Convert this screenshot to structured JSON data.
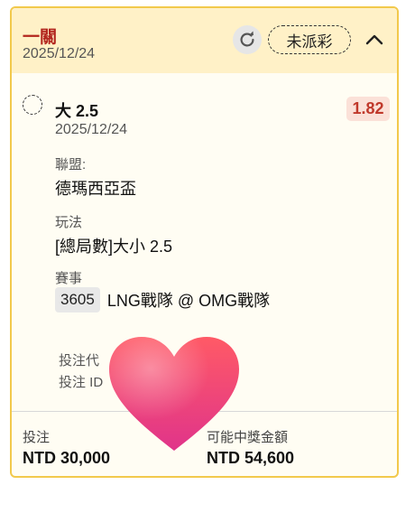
{
  "header": {
    "bet_type": "一關",
    "date": "2025/12/24",
    "status": "未派彩",
    "refresh_icon": "refresh-icon",
    "collapse_icon": "chevron-up-icon"
  },
  "selection": {
    "title": "大 2.5",
    "odds": "1.82",
    "date": "2025/12/24"
  },
  "details": {
    "league_label": "聯盟:",
    "league_value": "德瑪西亞盃",
    "market_label": "玩法",
    "market_value": "[總局數]大小 2.5",
    "event_label": "賽事",
    "match_id": "3605",
    "match_name": "LNG戰隊 @ OMG戰隊",
    "bet_code_label": "投注代",
    "bet_id_label": "投注 ID"
  },
  "footer": {
    "stake_label": "投注",
    "stake_value": "NTD 30,000",
    "payout_label": "可能中獎金額",
    "payout_value": "NTD 54,600"
  },
  "overlay": {
    "icon": "heart-icon",
    "colors": {
      "top": "#ff5a66",
      "bottom": "#e0348a"
    }
  },
  "colors": {
    "border": "#f2c94c",
    "header_bg": "#fff1c7",
    "card_bg": "#fffdf3",
    "accent_red": "#b3261e",
    "odds_bg": "#fbe1d8"
  }
}
